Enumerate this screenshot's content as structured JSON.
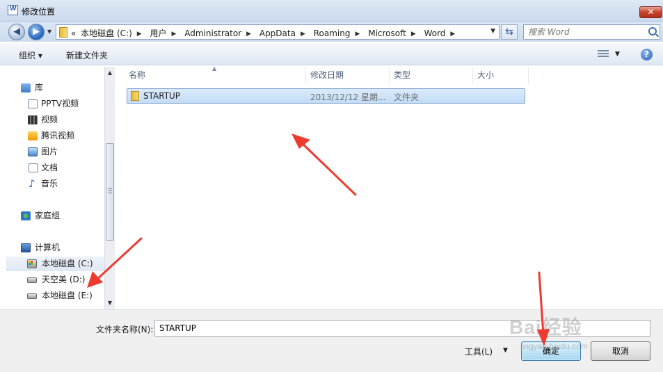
{
  "window": {
    "title": "修改位置",
    "close_glyph": "✕"
  },
  "address": {
    "overflow": "«",
    "crumbs": [
      "本地磁盘 (C:)",
      "用户",
      "Administrator",
      "AppData",
      "Roaming",
      "Microsoft",
      "Word"
    ],
    "search_placeholder": "搜索 Word"
  },
  "toolbar": {
    "organize": "组织 ▾",
    "new_folder": "新建文件夹",
    "help": "?"
  },
  "nav": {
    "items": [
      {
        "label": "库"
      },
      {
        "label": "PPTV视频"
      },
      {
        "label": "视频"
      },
      {
        "label": "腾讯视频"
      },
      {
        "label": "图片"
      },
      {
        "label": "文档"
      },
      {
        "label": "音乐"
      },
      {
        "label": "家庭组"
      },
      {
        "label": "计算机"
      },
      {
        "label": "本地磁盘 (C:)"
      },
      {
        "label": "天空美 (D:)"
      },
      {
        "label": "本地磁盘 (E:)"
      }
    ]
  },
  "list": {
    "columns": [
      "名称",
      "修改日期",
      "类型",
      "大小"
    ],
    "rows": [
      {
        "name": "STARTUP",
        "modified": "2013/12/12 星期...",
        "type": "文件夹",
        "size": ""
      }
    ]
  },
  "bottom": {
    "folder_name_label": "文件夹名称(N):",
    "folder_name_value": "STARTUP",
    "tools_label": "工具(L)",
    "ok_label": "确定",
    "cancel_label": "取消"
  },
  "watermark": {
    "brand": "Bai经验",
    "url": "jingyan.baidu.com"
  },
  "colors": {
    "arrow": "#ee3b2f",
    "selection": "#c3dcf6",
    "accent": "#2b579a"
  }
}
